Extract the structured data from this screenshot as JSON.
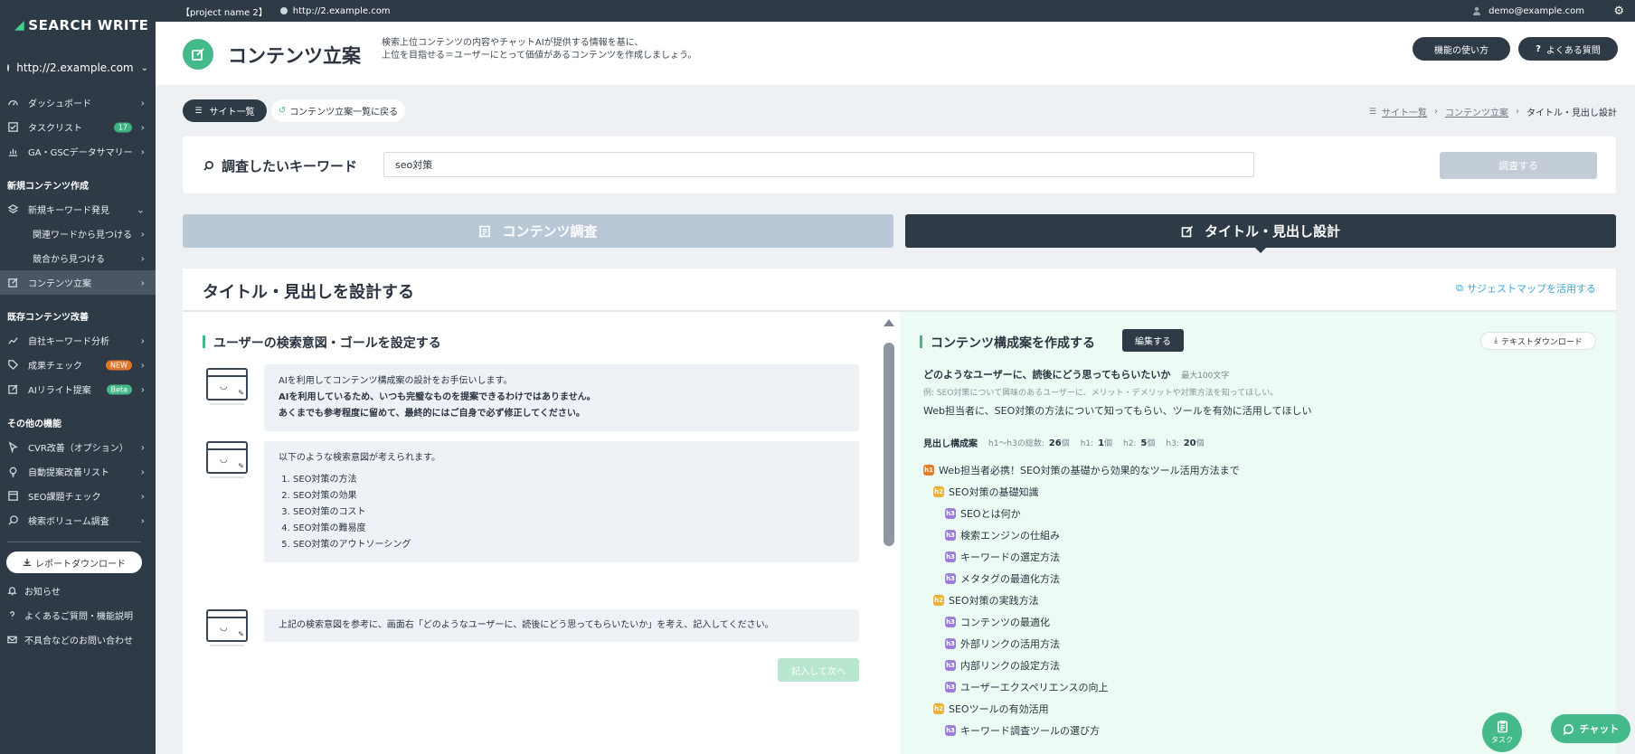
{
  "brand": {
    "name": "SEARCH WRITE"
  },
  "sidebar": {
    "site": "http://2.example.com",
    "nav_main": [
      {
        "label": "ダッシュボード",
        "icon": "gauge-icon"
      },
      {
        "label": "タスクリスト",
        "icon": "checklist-icon",
        "badge": "17"
      },
      {
        "label": "GA・GSCデータサマリー",
        "icon": "chart-icon"
      }
    ],
    "section_new": "新規コンテンツ作成",
    "nav_new": [
      {
        "label": "新規キーワード発見",
        "icon": "layers-icon"
      },
      {
        "label": "関連ワードから見つける"
      },
      {
        "label": "競合から見つける"
      },
      {
        "label": "コンテンツ立案",
        "icon": "edit-icon"
      }
    ],
    "section_existing": "既存コンテンツ改善",
    "nav_existing": [
      {
        "label": "自社キーワード分析",
        "icon": "trend-icon"
      },
      {
        "label": "成果チェック",
        "icon": "tag-icon",
        "badge": "NEW"
      },
      {
        "label": "AIリライト提案",
        "icon": "edit-icon",
        "badge": "Beta"
      }
    ],
    "section_other": "その他の機能",
    "nav_other": [
      {
        "label": "CVR改善（オプション）",
        "icon": "cursor-icon"
      },
      {
        "label": "自動提案改善リスト",
        "icon": "bulb-icon"
      },
      {
        "label": "SEO課題チェック",
        "icon": "window-icon"
      },
      {
        "label": "検索ボリューム調査",
        "icon": "search-icon"
      }
    ],
    "report_download": "レポートダウンロード",
    "footer": [
      {
        "label": "お知らせ",
        "icon": "bell-icon"
      },
      {
        "label": "よくあるご質問・機能説明",
        "icon": "question-icon"
      },
      {
        "label": "不具合などのお問い合わせ",
        "icon": "mail-icon"
      }
    ]
  },
  "topbar": {
    "project": "【project name 2】",
    "url": "http://2.example.com",
    "user": "demo@example.com"
  },
  "header": {
    "title": "コンテンツ立案",
    "desc_line1": "検索上位コンテンツの内容やチャットAIが提供する情報を基に、",
    "desc_line2": "上位を目指せる＝ユーザーにとって価値があるコンテンツを作成しましょう。",
    "howto_label": "機能の使い方",
    "faq_label": "よくある質問"
  },
  "subbar": {
    "site_list": "サイト一覧",
    "back": "コンテンツ立案一覧に戻る",
    "breadcrumb": [
      "サイト一覧",
      "コンテンツ立案",
      "タイトル・見出し設計"
    ]
  },
  "keyword": {
    "label": "調査したいキーワード",
    "value": "seo対策",
    "button": "調査する"
  },
  "tabs": {
    "research": "コンテンツ調査",
    "design": "タイトル・見出し設計"
  },
  "panel": {
    "title": "タイトル・見出しを設計する",
    "suggest_link": "サジェストマップを活用する"
  },
  "left": {
    "title": "ユーザーの検索意図・ゴールを設定する",
    "msg1_line1": "AIを利用してコンテンツ構成案の設計をお手伝いします。",
    "msg1_line2": "AIを利用しているため、いつも完璧なものを提案できるわけではありません。",
    "msg1_line3": "あくまでも参考程度に留めて、最終的にはご自身で必ず修正してください。",
    "msg2_intro": "以下のような検索意図が考えられます。",
    "intents": [
      "SEO対策の方法",
      "SEO対策の効果",
      "SEO対策のコスト",
      "SEO対策の難易度",
      "SEO対策のアウトソーシング"
    ],
    "msg3": "上記の検索意図を参考に、画面右「どのようなユーザーに、読後にどう思ってもらいたいか」を考え、記入してください。",
    "next_button": "記入して次へ"
  },
  "right": {
    "title": "コンテンツ構成案を作成する",
    "edit_button": "編集する",
    "download_button": "テキストダウンロード",
    "question": "どのようなユーザーに、読後にどう思ってもらいたいか",
    "limit": "最大100文字",
    "example": "例: SEO対策について興味のあるユーザーに、メリット・デメリットや対策方法を知ってほしい。",
    "answer": "Web担当者に、SEO対策の方法について知ってもらい、ツールを有効に活用してほしい",
    "outline_label": "見出し構成案",
    "stats": {
      "total_label": "h1〜h3の総数:",
      "total": "26",
      "total_unit": "個",
      "h1_label": "h1:",
      "h1": "1",
      "h1_unit": "個",
      "h2_label": "h2:",
      "h2": "5",
      "h2_unit": "個",
      "h3_label": "h3:",
      "h3": "20",
      "h3_unit": "個"
    },
    "outline": [
      {
        "level": "h1",
        "text": "Web担当者必携！SEO対策の基礎から効果的なツール活用方法まで"
      },
      {
        "level": "h2",
        "text": "SEO対策の基礎知識"
      },
      {
        "level": "h3",
        "text": "SEOとは何か"
      },
      {
        "level": "h3",
        "text": "検索エンジンの仕組み"
      },
      {
        "level": "h3",
        "text": "キーワードの選定方法"
      },
      {
        "level": "h3",
        "text": "メタタグの最適化方法"
      },
      {
        "level": "h2",
        "text": "SEO対策の実践方法"
      },
      {
        "level": "h3",
        "text": "コンテンツの最適化"
      },
      {
        "level": "h3",
        "text": "外部リンクの活用方法"
      },
      {
        "level": "h3",
        "text": "内部リンクの設定方法"
      },
      {
        "level": "h3",
        "text": "ユーザーエクスペリエンスの向上"
      },
      {
        "level": "h2",
        "text": "SEOツールの有効活用"
      },
      {
        "level": "h3",
        "text": "キーワード調査ツールの選び方"
      }
    ]
  },
  "fab": {
    "task": "タスク",
    "chat": "チャット"
  }
}
